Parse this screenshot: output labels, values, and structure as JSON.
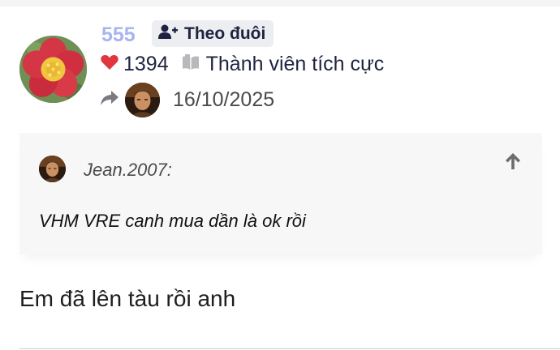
{
  "post": {
    "username": "555",
    "follow_label": "Theo đuôi",
    "likes": "1394",
    "rank": "Thành viên tích cực",
    "date": "16/10/2025",
    "quote": {
      "author": "Jean.2007:",
      "text": "VHM VRE canh mua dần là ok rồi"
    },
    "body": "Em đã lên tàu rồi anh"
  },
  "icons": {
    "follow": "user-plus-icon",
    "like": "heart-icon",
    "rank": "book-icon",
    "reply": "share-arrow-icon",
    "up": "arrow-up-icon"
  },
  "colors": {
    "username": "#a9b5ef",
    "heart": "#e0363e",
    "text_dark": "#1f2340",
    "quote_bg": "#f7f7f8"
  }
}
